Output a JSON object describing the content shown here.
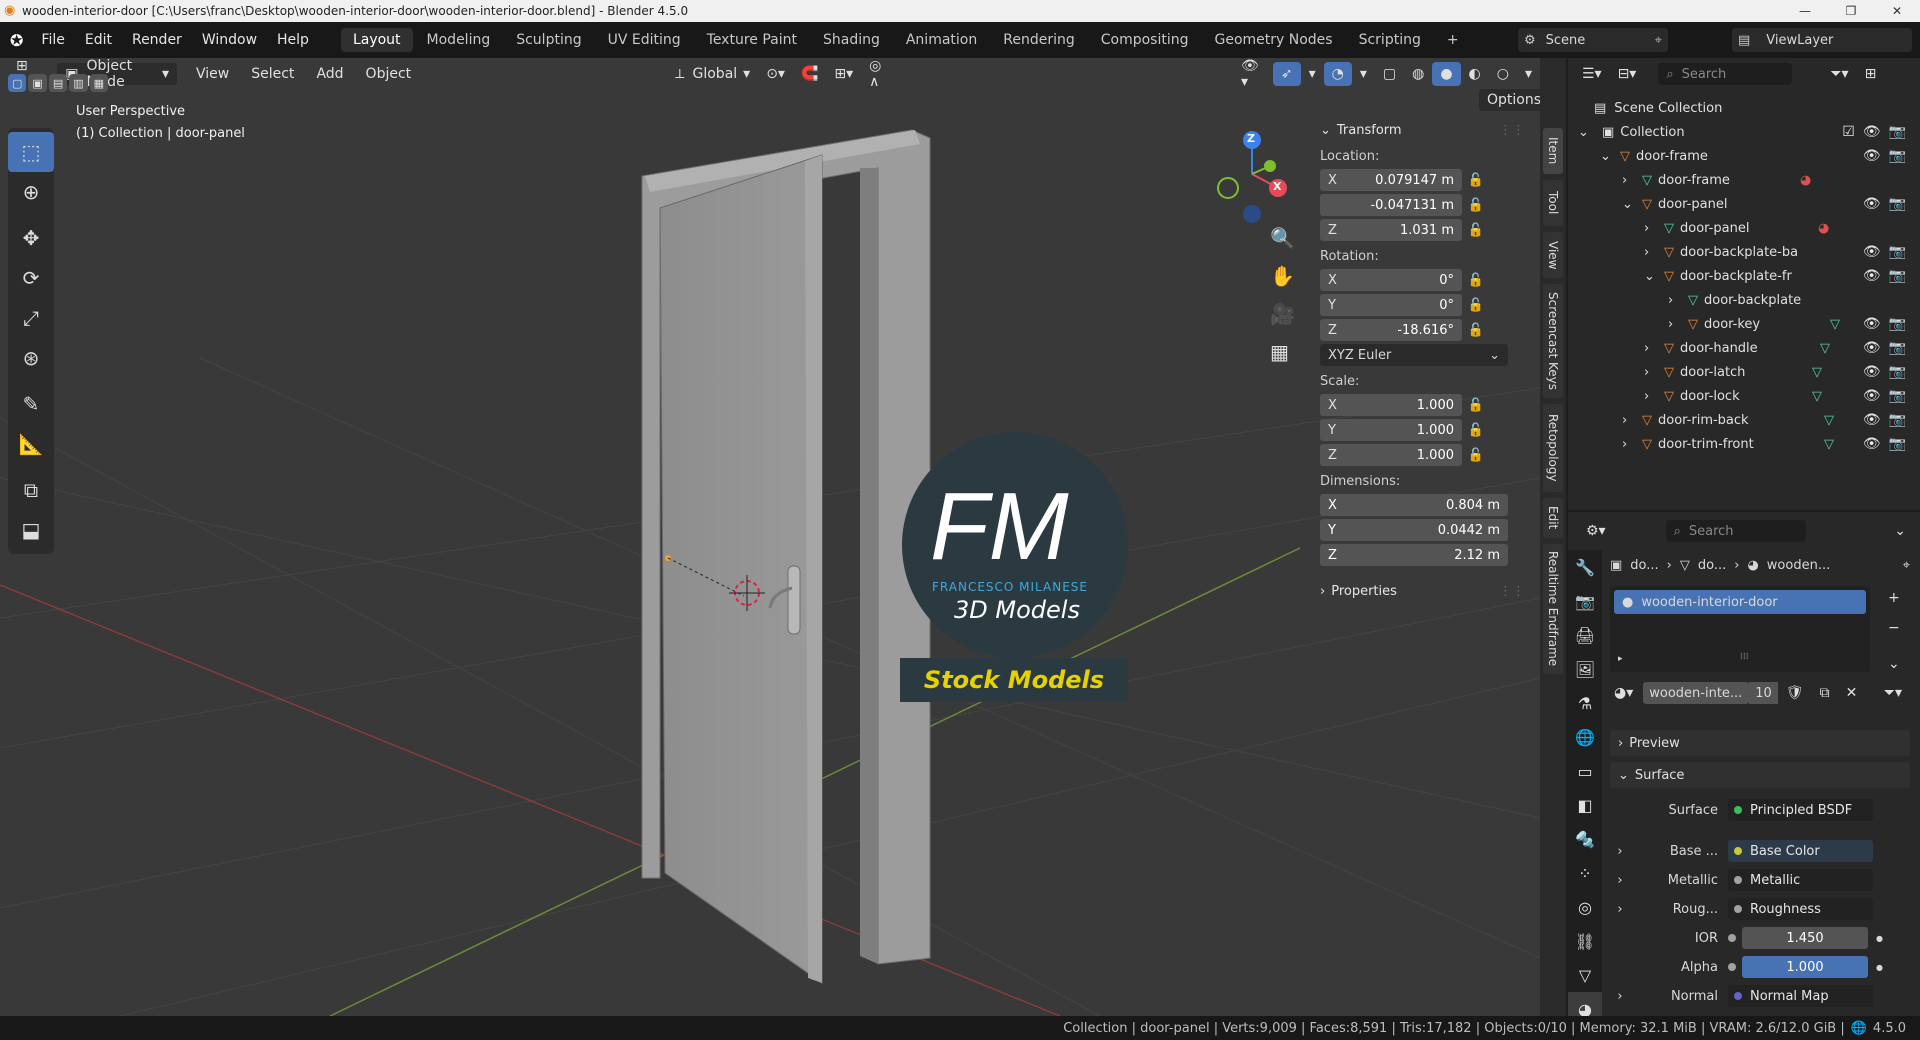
{
  "window": {
    "title": "wooden-interior-door [C:\\Users\\franc\\Desktop\\wooden-interior-door\\wooden-interior-door.blend] - Blender 4.5.0"
  },
  "menubar": {
    "file": "File",
    "edit": "Edit",
    "render": "Render",
    "window": "Window",
    "help": "Help",
    "tabs": [
      "Layout",
      "Modeling",
      "Sculpting",
      "UV Editing",
      "Texture Paint",
      "Shading",
      "Animation",
      "Rendering",
      "Compositing",
      "Geometry Nodes",
      "Scripting"
    ],
    "scene": "Scene",
    "view_layer": "ViewLayer"
  },
  "viewport": {
    "mode": "Object Mode",
    "view": "View",
    "select": "Select",
    "add": "Add",
    "object": "Object",
    "orientation": "Global",
    "options": "Options",
    "perspective": "User Perspective",
    "collection_info": "(1) Collection | door-panel",
    "gizmo": {
      "z": "Z",
      "x": "X"
    },
    "logo": {
      "letters": "FM",
      "brand": "FRANCESCO MILANESE",
      "tagline": "3D Models",
      "banner": "Stock Models"
    }
  },
  "npanel": {
    "transform": "Transform",
    "location_label": "Location:",
    "location": [
      {
        "axis": "X",
        "value": "0.079147 m"
      },
      {
        "axis": "",
        "value": "-0.047131 m"
      },
      {
        "axis": "Z",
        "value": "1.031 m"
      }
    ],
    "rotation_label": "Rotation:",
    "rotation": [
      {
        "axis": "X",
        "value": "0°"
      },
      {
        "axis": "Y",
        "value": "0°"
      },
      {
        "axis": "Z",
        "value": "-18.616°"
      }
    ],
    "rotation_mode": "XYZ Euler",
    "scale_label": "Scale:",
    "scale": [
      {
        "axis": "X",
        "value": "1.000"
      },
      {
        "axis": "Y",
        "value": "1.000"
      },
      {
        "axis": "Z",
        "value": "1.000"
      }
    ],
    "dimensions_label": "Dimensions:",
    "dimensions": [
      {
        "axis": "X",
        "value": "0.804 m"
      },
      {
        "axis": "Y",
        "value": "0.0442 m"
      },
      {
        "axis": "Z",
        "value": "2.12 m"
      }
    ],
    "properties": "Properties",
    "side_tabs": [
      "Item",
      "Tool",
      "View",
      "Screencast Keys",
      "Retopology",
      "Edit",
      "Realtime Endframe"
    ]
  },
  "outliner": {
    "search_placeholder": "Search",
    "scene_collection": "Scene Collection",
    "rows": [
      {
        "name": "Collection"
      },
      {
        "name": "door-frame"
      },
      {
        "name": "door-frame"
      },
      {
        "name": "door-panel"
      },
      {
        "name": "door-panel"
      },
      {
        "name": "door-backplate-ba"
      },
      {
        "name": "door-backplate-fr"
      },
      {
        "name": "door-backplate"
      },
      {
        "name": "door-key"
      },
      {
        "name": "door-handle"
      },
      {
        "name": "door-latch"
      },
      {
        "name": "door-lock"
      },
      {
        "name": "door-rim-back"
      },
      {
        "name": "door-trim-front"
      }
    ]
  },
  "properties": {
    "search_placeholder": "Search",
    "breadcrumb": [
      "do...",
      "do...",
      "wooden..."
    ],
    "material_slot": "wooden-interior-door",
    "material_name": "wooden-inte...",
    "users": "10",
    "preview": "Preview",
    "surface_section": "Surface",
    "surface_label": "Surface",
    "surface_value": "Principled BSDF",
    "inputs": [
      {
        "label": "Base ...",
        "value": "Base Color",
        "color": "#c7c73a"
      },
      {
        "label": "Metallic",
        "value": "Metallic",
        "color": "#a1a1a1"
      },
      {
        "label": "Roug...",
        "value": "Roughness",
        "color": "#a1a1a1"
      }
    ],
    "ior_label": "IOR",
    "ior": "1.450",
    "alpha_label": "Alpha",
    "alpha": "1.000",
    "normal_label": "Normal",
    "normal_value": "Normal Map"
  },
  "statusbar": {
    "text": "Collection | door-panel | Verts:9,009 | Faces:8,591 | Tris:17,182 | Objects:0/10 | Memory: 32.1 MiB | VRAM: 2.6/12.0 GiB |",
    "version": "4.5.0"
  },
  "colors": {
    "accent": "#4772b3",
    "selected_row": "#334d80",
    "object_orange": "#e8873a",
    "mesh_green": "#5ad0a0"
  }
}
